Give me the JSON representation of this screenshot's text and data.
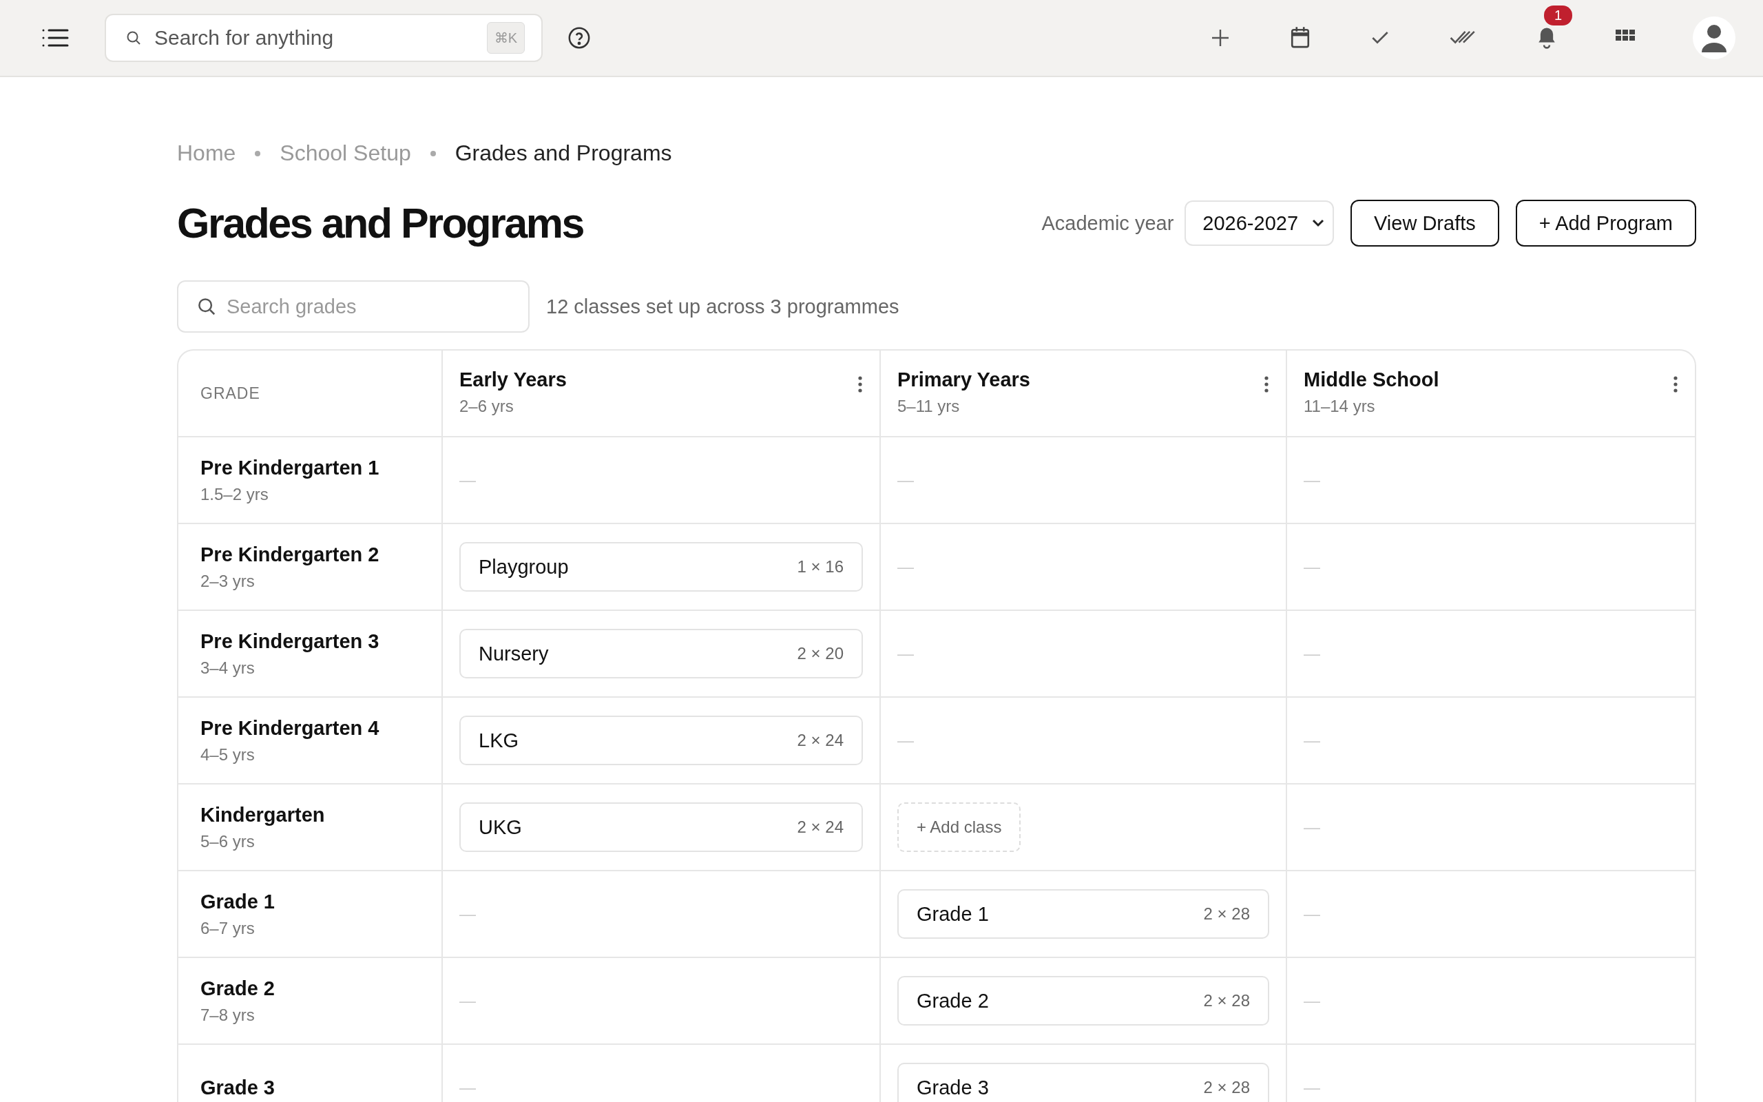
{
  "topbar": {
    "search": {
      "placeholder": "Search for anything",
      "shortcut": "⌘K"
    },
    "notifications": {
      "count": "1"
    }
  },
  "breadcrumb": [
    {
      "label": "Home",
      "current": false
    },
    {
      "label": "School Setup",
      "current": false
    },
    {
      "label": "Grades and Programs",
      "current": true
    }
  ],
  "title": "Grades and Programs",
  "academic_year": {
    "label": "Academic year",
    "value": "2026-2027"
  },
  "actions": [
    "View Drafts",
    "+ Add Program"
  ],
  "grade_search": {
    "placeholder": "Search grades"
  },
  "summary": "12 classes set up across 3 programmes",
  "table": {
    "first_column": "GRADE",
    "programs": [
      {
        "name": "Early Years",
        "ages": "2–6 yrs"
      },
      {
        "name": "Primary Years",
        "ages": "5–11 yrs"
      },
      {
        "name": "Middle School",
        "ages": "11–14 yrs"
      }
    ],
    "rows": [
      {
        "grade": "Pre Kindergarten 1",
        "ages": "1.5–2 yrs",
        "cells": [
          {
            "kind": "empty",
            "text": "—"
          },
          {
            "kind": "empty",
            "text": "—"
          },
          {
            "kind": "empty",
            "text": "—"
          }
        ]
      },
      {
        "grade": "Pre Kindergarten 2",
        "ages": "2–3 yrs",
        "cells": [
          {
            "kind": "class",
            "name": "Playgroup",
            "size": "1 × 16"
          },
          {
            "kind": "empty",
            "text": "—"
          },
          {
            "kind": "empty",
            "text": "—"
          }
        ]
      },
      {
        "grade": "Pre Kindergarten 3",
        "ages": "3–4 yrs",
        "cells": [
          {
            "kind": "class",
            "name": "Nursery",
            "size": "2 × 20"
          },
          {
            "kind": "empty",
            "text": "—"
          },
          {
            "kind": "empty",
            "text": "—"
          }
        ]
      },
      {
        "grade": "Pre Kindergarten 4",
        "ages": "4–5 yrs",
        "cells": [
          {
            "kind": "class",
            "name": "LKG",
            "size": "2 × 24"
          },
          {
            "kind": "empty",
            "text": "—"
          },
          {
            "kind": "empty",
            "text": "—"
          }
        ]
      },
      {
        "grade": "Kindergarten",
        "ages": "5–6 yrs",
        "cells": [
          {
            "kind": "class",
            "name": "UKG",
            "size": "2 × 24"
          },
          {
            "kind": "add",
            "label": "+ Add class"
          },
          {
            "kind": "empty",
            "text": "—"
          }
        ]
      },
      {
        "grade": "Grade 1",
        "ages": "6–7 yrs",
        "cells": [
          {
            "kind": "empty",
            "text": "—"
          },
          {
            "kind": "class",
            "name": "Grade 1",
            "size": "2 × 28"
          },
          {
            "kind": "empty",
            "text": "—"
          }
        ]
      },
      {
        "grade": "Grade 2",
        "ages": "7–8 yrs",
        "cells": [
          {
            "kind": "empty",
            "text": "—"
          },
          {
            "kind": "class",
            "name": "Grade 2",
            "size": "2 × 28"
          },
          {
            "kind": "empty",
            "text": "—"
          }
        ]
      },
      {
        "grade": "Grade 3",
        "cells": [
          {
            "kind": "empty",
            "text": "—"
          },
          {
            "kind": "class",
            "name": "Grade 3",
            "size": "2 × 28"
          },
          {
            "kind": "empty",
            "text": "—"
          }
        ]
      }
    ]
  }
}
